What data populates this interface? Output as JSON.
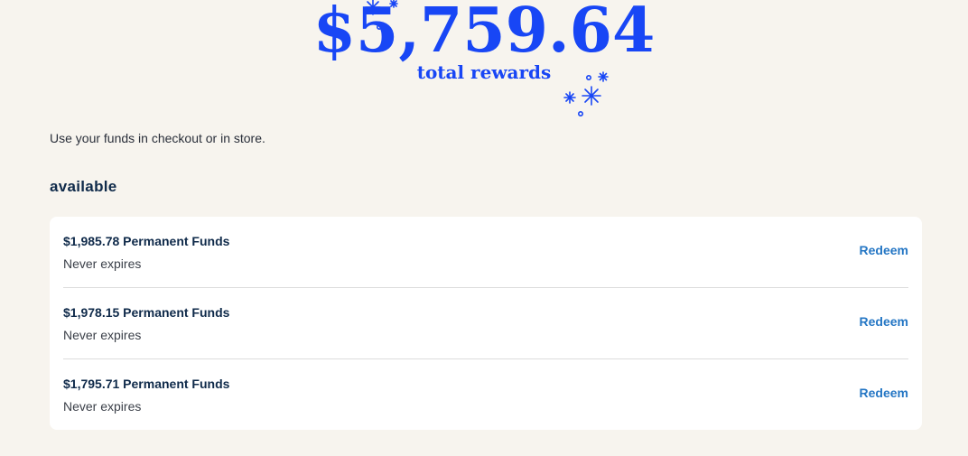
{
  "rewards": {
    "total_amount": "$5,759.64",
    "total_label": "total rewards",
    "accent_color": "#1846f5"
  },
  "instructions": "Use your funds in checkout or in store.",
  "available": {
    "title": "available",
    "funds": [
      {
        "title": "$1,985.78 Permanent Funds",
        "subtitle": "Never expires",
        "action": "Redeem"
      },
      {
        "title": "$1,978.15 Permanent Funds",
        "subtitle": "Never expires",
        "action": "Redeem"
      },
      {
        "title": "$1,795.71 Permanent Funds",
        "subtitle": "Never expires",
        "action": "Redeem"
      }
    ]
  },
  "icons": {
    "decoration": "sparkle-icon"
  }
}
